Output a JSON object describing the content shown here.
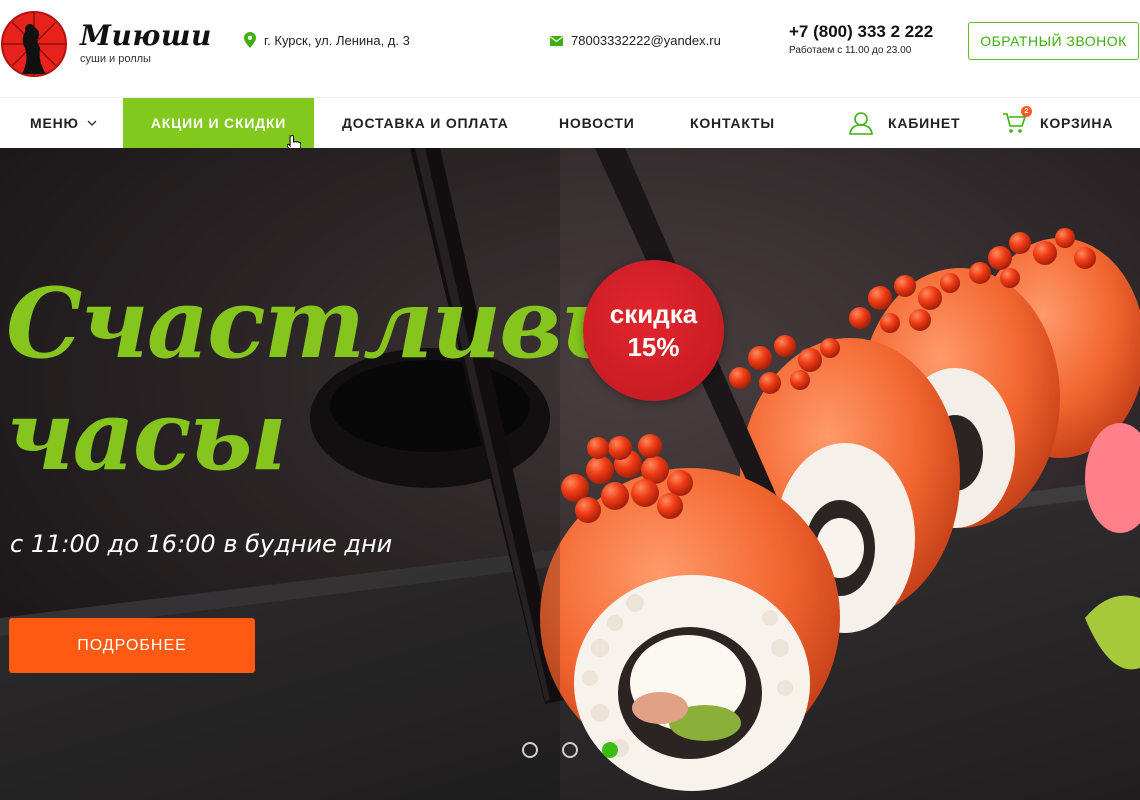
{
  "header": {
    "brand_name": "Миюши",
    "brand_sub": "суши и роллы",
    "address": "г. Курск, ул. Ленина, д. 3",
    "email": "78003332222@yandex.ru",
    "phone": "+7 (800) 333 2 222",
    "hours": "Работаем с 11.00 до 23.00",
    "callback_label": "ОБРАТНЫЙ ЗВОНОК"
  },
  "nav": {
    "menu": "МЕНЮ",
    "sale": "АКЦИИ И СКИДКИ",
    "delivery": "ДОСТАВКА И ОПЛАТА",
    "news": "НОВОСТИ",
    "contacts": "КОНТАКТЫ",
    "cabinet": "КАБИНЕТ",
    "cart": "КОРЗИНА",
    "cart_count": "2",
    "active_item": "sale"
  },
  "hero": {
    "title_line1": "Счастливые",
    "title_line2": "часы",
    "subtitle": "с 11:00 до 16:00 в будние дни",
    "button_label": "ПОДРОБНЕЕ",
    "badge_line1": "скидка",
    "badge_line2": "15%",
    "slides_total": 3,
    "active_slide": 3
  },
  "colors": {
    "accent_green": "#82c91e",
    "button_orange": "#ff5a14",
    "badge_red": "#d41f27"
  },
  "icons": [
    "umbrella-logo-icon",
    "map-pin-icon",
    "envelope-icon",
    "chevron-down-icon",
    "user-icon",
    "cart-icon"
  ]
}
